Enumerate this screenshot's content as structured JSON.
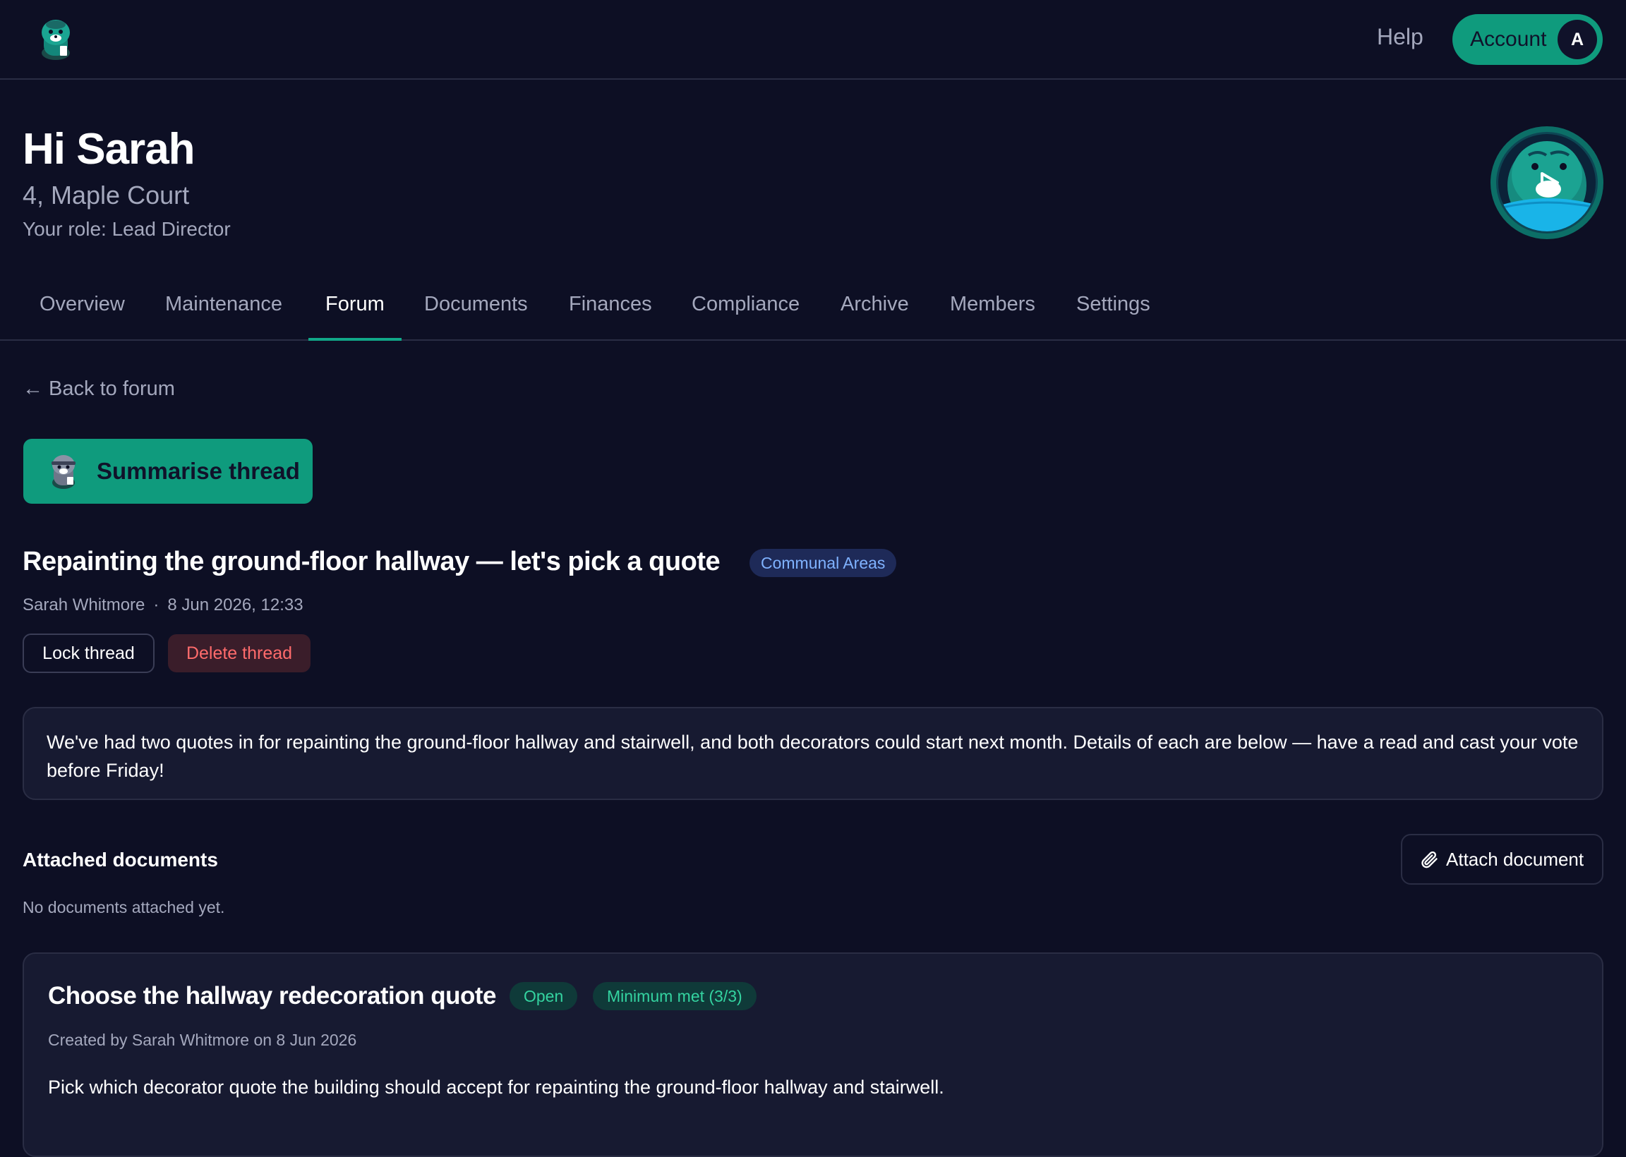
{
  "topbar": {
    "help_label": "Help",
    "account_label": "Account",
    "account_initial": "A"
  },
  "header": {
    "greeting": "Hi Sarah",
    "address": "4, Maple Court",
    "role": "Your role: Lead Director"
  },
  "tabs": [
    {
      "label": "Overview",
      "active": false
    },
    {
      "label": "Maintenance",
      "active": false
    },
    {
      "label": "Forum",
      "active": true
    },
    {
      "label": "Documents",
      "active": false
    },
    {
      "label": "Finances",
      "active": false
    },
    {
      "label": "Compliance",
      "active": false
    },
    {
      "label": "Archive",
      "active": false
    },
    {
      "label": "Members",
      "active": false
    },
    {
      "label": "Settings",
      "active": false
    }
  ],
  "thread": {
    "back_label": "← Back to forum",
    "summarise_label": "Summarise thread",
    "title": "Repainting the ground-floor hallway — let's pick a quote",
    "category": "Communal Areas",
    "author": "Sarah Whitmore",
    "separator": "·",
    "date": "8 Jun 2026, 12:33",
    "lock_label": "Lock thread",
    "delete_label": "Delete thread",
    "body": "We've had two quotes in for repainting the ground-floor hallway and stairwell, and both decorators could start next month. Details of each are below — have a read and cast your vote before Friday!"
  },
  "attachments": {
    "heading": "Attached documents",
    "attach_label": "Attach document",
    "empty_text": "No documents attached yet."
  },
  "poll": {
    "title": "Choose the hallway redecoration quote",
    "status": "Open",
    "minimum": "Minimum met (3/3)",
    "meta": "Created by Sarah Whitmore on 8 Jun 2026",
    "description": "Pick which decorator quote the building should accept for repainting the ground-floor hallway and stairwell."
  },
  "colors": {
    "background": "#0d0f24",
    "accent": "#0f9b7d",
    "danger": "#ff6b6b",
    "badge_blue": "#7fb2ff",
    "badge_green": "#34d3a0"
  },
  "icons": {
    "logo": "mascot-logo-icon",
    "mascot": "mascot-video-icon",
    "summarise": "mascot-mini-icon",
    "attach": "paperclip-icon"
  }
}
